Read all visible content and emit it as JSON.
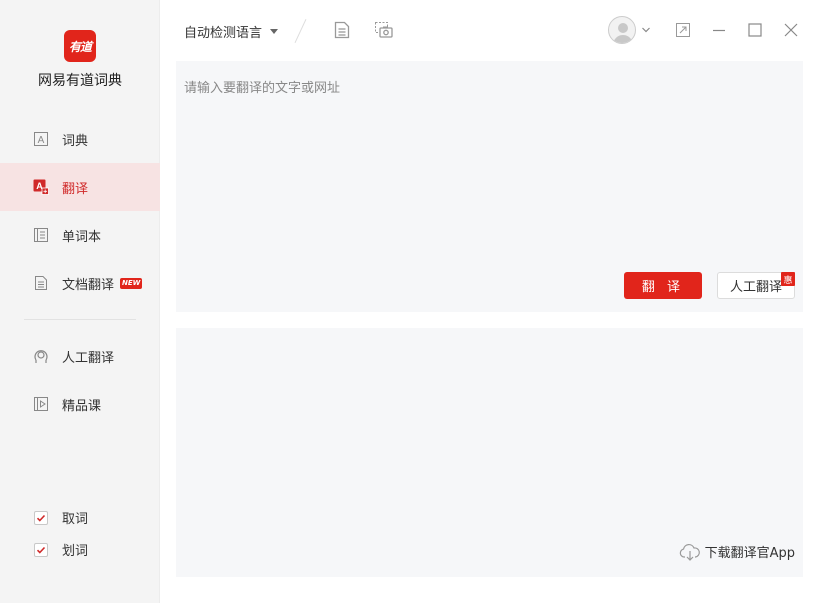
{
  "sidebar": {
    "logo_text": "有道",
    "app_name": "网易有道词典",
    "items": [
      {
        "label": "词典",
        "icon": "dictionary-icon"
      },
      {
        "label": "翻译",
        "icon": "translate-icon",
        "active": true
      },
      {
        "label": "单词本",
        "icon": "wordbook-icon"
      },
      {
        "label": "文档翻译",
        "icon": "document-icon",
        "badge": "NEW"
      },
      {
        "label": "人工翻译",
        "icon": "human-translate-icon"
      },
      {
        "label": "精品课",
        "icon": "course-icon"
      }
    ],
    "checks": [
      {
        "label": "取词",
        "checked": true
      },
      {
        "label": "划词",
        "checked": true
      }
    ]
  },
  "toolbar": {
    "language": "自动检测语言"
  },
  "input": {
    "placeholder": "请输入要翻译的文字或网址",
    "value": ""
  },
  "actions": {
    "translate_label": "翻 译",
    "human_label": "人工翻译",
    "human_tag": "惠"
  },
  "output": {
    "download_label": "下载翻译官App"
  },
  "colors": {
    "accent": "#e1251b",
    "active_bg": "#f7e3e3",
    "sidebar_bg": "#f4f4f4",
    "panel_bg": "#f6f7f9"
  }
}
